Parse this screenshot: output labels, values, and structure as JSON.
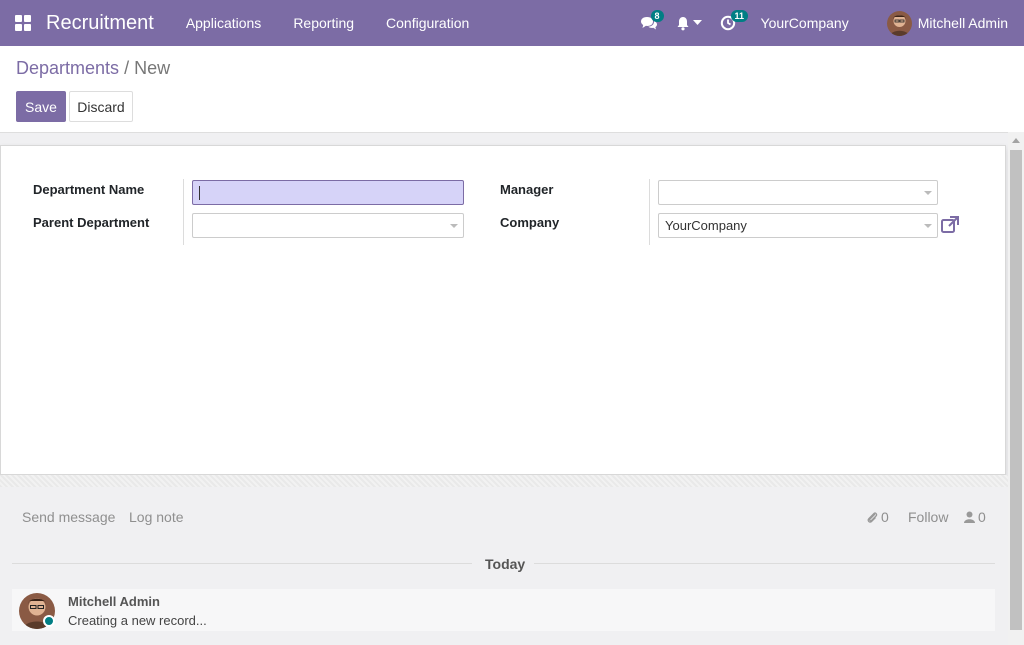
{
  "navbar": {
    "brand": "Recruitment",
    "menu": [
      {
        "label": "Applications"
      },
      {
        "label": "Reporting"
      },
      {
        "label": "Configuration"
      }
    ],
    "messages_badge": "8",
    "activities_badge": "11",
    "company": "YourCompany",
    "user": "Mitchell Admin"
  },
  "breadcrumb": {
    "parent": "Departments",
    "separator": "/",
    "current": "New"
  },
  "buttons": {
    "save": "Save",
    "discard": "Discard"
  },
  "form": {
    "department_name_label": "Department Name",
    "department_name_value": "",
    "parent_department_label": "Parent Department",
    "parent_department_value": "",
    "manager_label": "Manager",
    "manager_value": "",
    "company_label": "Company",
    "company_value": "YourCompany"
  },
  "chatter": {
    "send_message": "Send message",
    "log_note": "Log note",
    "attachments_count": "0",
    "follow": "Follow",
    "followers_count": "0",
    "date_separator": "Today",
    "messages": [
      {
        "author": "Mitchell Admin",
        "body": "Creating a new record..."
      }
    ]
  },
  "colors": {
    "brand": "#7c6ca5",
    "badge": "#017e84",
    "active_field": "#d6d3f8"
  }
}
